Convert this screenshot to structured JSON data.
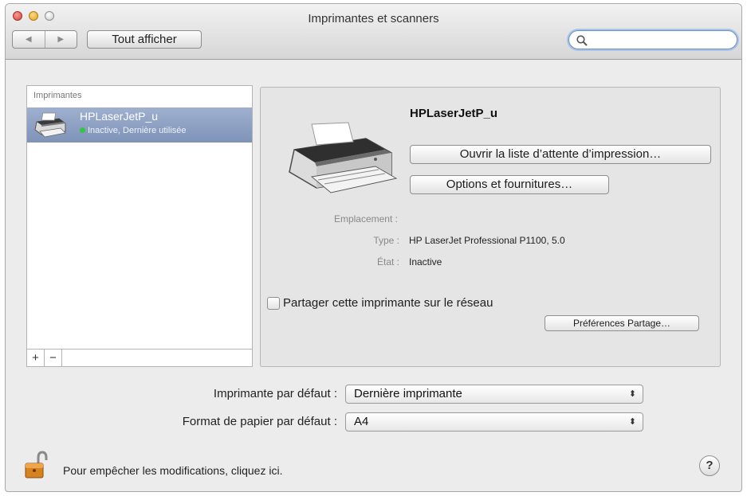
{
  "window": {
    "title": "Imprimantes et scanners",
    "show_all_label": "Tout afficher",
    "nav_back_glyph": "◀",
    "nav_forward_glyph": "▶",
    "search_value": "",
    "search_icon": "search-icon"
  },
  "printer_list": {
    "header": "Imprimantes",
    "items": [
      {
        "name": "HPLaserJetP_u",
        "status": "Inactive, Dernière utilisée",
        "status_color": "#39c445"
      }
    ],
    "add_label": "+",
    "remove_label": "−"
  },
  "detail": {
    "name": "HPLaserJetP_u",
    "queue_button": "Ouvrir la liste d’attente d’impression…",
    "options_button": "Options et fournitures…",
    "location_label": "Emplacement :",
    "type_label": "Type :",
    "type_value": "HP LaserJet Professional P1100, 5.0",
    "state_label": "État :",
    "state_value": "Inactive",
    "share_label": "Partager cette imprimante sur le réseau",
    "share_checked": false,
    "sharing_prefs_button": "Préférences Partage…"
  },
  "defaults": {
    "printer_label": "Imprimante par défaut :",
    "printer_value": "Dernière imprimante",
    "paper_label": "Format de papier par défaut :",
    "paper_value": "A4",
    "arrows_glyph": "⬍"
  },
  "footer": {
    "lock_text": "Pour empêcher les modifications, cliquez ici.",
    "help_label": "?"
  },
  "colors": {
    "selection": "#8c9ec2",
    "search_focus": "#a9c4ea",
    "lock_body": "#d6821f"
  }
}
